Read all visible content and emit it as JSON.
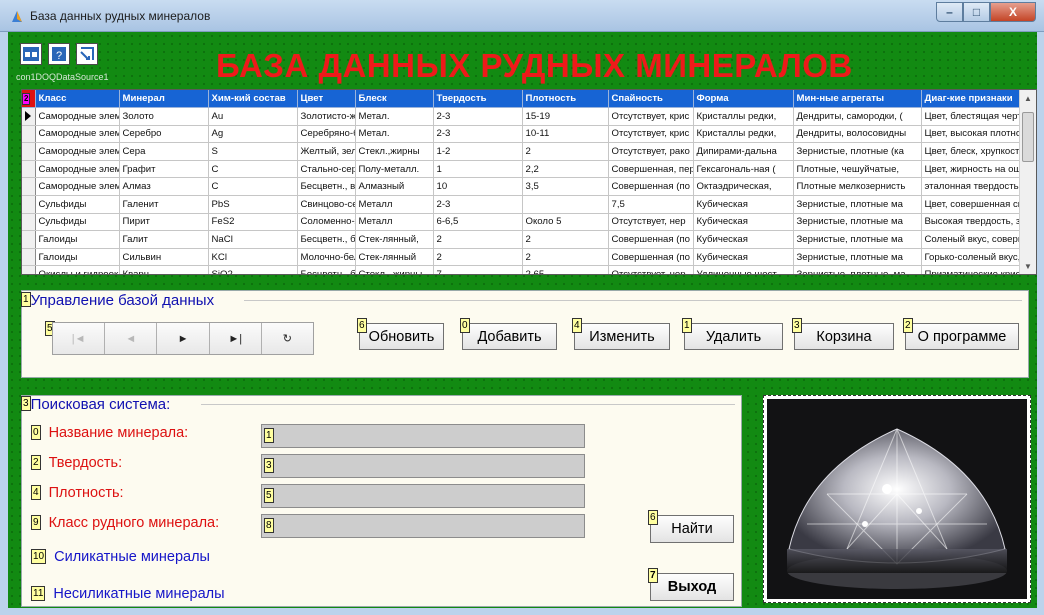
{
  "window": {
    "title": "База данных рудных минералов",
    "controls": {
      "minimize": "–",
      "maximize": "□",
      "close": "X"
    }
  },
  "toolbar": {
    "icons": [
      "ado-connection-icon",
      "ado-dataset-icon",
      "ado-query-icon"
    ],
    "datasource_label": "con1DOQDataSource1"
  },
  "header": {
    "title": "БАЗА ДАННЫХ РУДНЫХ МИНЕРАЛОВ"
  },
  "grid": {
    "header_badge": "2",
    "columns": [
      "Класс",
      "Минерал",
      "Хим-кий состав",
      "Цвет",
      "Блеск",
      "Твердость",
      "Плотность",
      "Спайность",
      "Форма",
      "Мин-ные агрегаты",
      "Диаг-кие признаки"
    ],
    "rows": [
      [
        "Самородные элем",
        "Золото",
        "Au",
        "Золотисто-ж",
        "Метал.",
        "2-3",
        "15-19",
        "Отсутствует, крис",
        "Кристаллы редки,",
        "Дендриты, самородки, (",
        "Цвет, блестящая черта"
      ],
      [
        "Самородные элем",
        "Серебро",
        "Ag",
        "Серебряно-б",
        "Метал.",
        "2-3",
        "10-11",
        "Отсутствует, крис",
        "Кристаллы редки,",
        "Дендриты, волосовидны",
        "Цвет, высокая плотност"
      ],
      [
        "Самородные элем",
        "Сера",
        "S",
        "Желтый, зел",
        "Стекл.,жирны",
        "1-2",
        "2",
        "Отсутствует, рако",
        "Дипирами-дальна",
        "Зернистые, плотные (ка",
        "Цвет, блеск, хрупкость"
      ],
      [
        "Самородные элем",
        "Графит",
        "C",
        "Стально-сер",
        "Полу-металл.",
        "1",
        "2,2",
        "Совершенная, пер",
        "Гексагональ-ная (",
        "Плотные, чешуйчатые,",
        "Цвет, жирность на ощу"
      ],
      [
        "Самородные элем",
        "Алмаз",
        "C",
        "Бесцветн., в",
        "Алмазный",
        "10",
        "3,5",
        "Совершенная (по",
        "Октаэдрическая,",
        "Плотные мелкозернисть",
        "эталонная твердость, а"
      ],
      [
        "Сульфиды",
        "Галенит",
        "PbS",
        "Свинцово-се",
        "Металл",
        "2-3",
        "",
        "7,5",
        "Кубическая",
        "Зернистые, плотные ма",
        "Цвет, совершенная спа"
      ],
      [
        "Сульфиды",
        "Пирит",
        "FeS2",
        "Соломенно-ж",
        "Металл",
        "6-6,5",
        "Около 5",
        "Отсутствует, нер",
        "Кубическая",
        "Зернистые, плотные ма",
        "Высокая твердость, зол"
      ],
      [
        "Галоиды",
        "Галит",
        "NaCl",
        "Бесцветн., б",
        "Стек-лянный,",
        "2",
        "2",
        "Совершенная (по",
        "Кубическая",
        "Зернистые, плотные ма",
        "Соленый вкус, совершен"
      ],
      [
        "Галоиды",
        "Сильвин",
        "KCl",
        "Молочно-бел",
        "Стек-лянный",
        "2",
        "2",
        "Совершенная (по",
        "Кубическая",
        "Зернистые, плотные ма",
        "Горько-соленый вкус, с"
      ],
      [
        "Окислы и гидроок",
        "Кварц",
        "SiO2",
        "Бесцветн., б",
        "Стекл., жирны",
        "7",
        "2,65",
        "Отсутствует, нер",
        "Удлиненные шест",
        "Зернистые, плотные, ма",
        "Призматические криста"
      ]
    ]
  },
  "db_panel": {
    "caption": "Управление базой данных",
    "caption_badge": "1",
    "navigator_badge": "5",
    "navigator": [
      "|◄",
      "◄",
      "►",
      "►|",
      "↻"
    ],
    "buttons": [
      {
        "badge": "6",
        "label": "Обновить"
      },
      {
        "badge": "0",
        "label": "Добавить"
      },
      {
        "badge": "4",
        "label": "Изменить"
      },
      {
        "badge": "1",
        "label": "Удалить"
      },
      {
        "badge": "3",
        "label": "Корзина"
      },
      {
        "badge": "2",
        "label": "О программе"
      }
    ]
  },
  "search_panel": {
    "caption": "Поисковая система:",
    "caption_badge": "3",
    "fields": [
      {
        "badge": "0",
        "label": "Название минерала:",
        "field_badge": "1",
        "value": ""
      },
      {
        "badge": "2",
        "label": "Твердость:",
        "field_badge": "3",
        "value": ""
      },
      {
        "badge": "4",
        "label": "Плотность:",
        "field_badge": "5",
        "value": ""
      },
      {
        "badge": "9",
        "label": "Класс рудного минерала:",
        "field_badge": "8",
        "value": ""
      }
    ],
    "links": [
      {
        "badge": "10",
        "label": "Силикатные  минералы"
      },
      {
        "badge": "11",
        "label": "Несиликатные минералы"
      }
    ],
    "find_button": {
      "badge": "6",
      "label": "Найти"
    },
    "exit_button": {
      "badge": "7",
      "label": "Выход"
    }
  },
  "colors": {
    "form_green": "#128a12",
    "title_red": "#ee1a1a",
    "grid_header_blue": "#1764d4",
    "label_red": "#dd1111",
    "label_blue": "#1515c8"
  }
}
